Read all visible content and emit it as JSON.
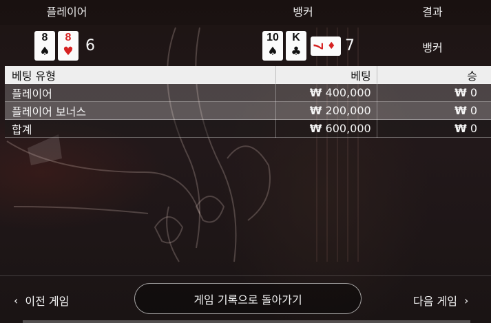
{
  "header": {
    "player": "플레이어",
    "banker": "뱅커",
    "result": "결과"
  },
  "player_hand": {
    "cards": [
      {
        "rank": "8",
        "suit": "♠",
        "color": "black"
      },
      {
        "rank": "8",
        "suit": "♥",
        "color": "red"
      }
    ],
    "score": "6"
  },
  "banker_hand": {
    "cards": [
      {
        "rank": "10",
        "suit": "♠",
        "color": "black"
      },
      {
        "rank": "K",
        "suit": "♣",
        "color": "black"
      }
    ],
    "third_card": {
      "rank": "7",
      "suit": "♦",
      "color": "red"
    },
    "score": "7"
  },
  "result": "뱅커",
  "bets_table": {
    "headers": {
      "type": "베팅 유형",
      "bet": "베팅",
      "win": "승"
    },
    "rows": [
      {
        "type": "플레이어",
        "currency": "₩",
        "bet": "400,000",
        "win": "0"
      },
      {
        "type": "플레이어 보너스",
        "currency": "₩",
        "bet": "200,000",
        "win": "0"
      },
      {
        "type": "합계",
        "currency": "₩",
        "bet": "600,000",
        "win": "0"
      }
    ]
  },
  "footer": {
    "prev_label": "이전 게임",
    "back_label": "게임 기록으로 돌아가기",
    "next_label": "다음 게임"
  },
  "icons": {
    "prev": "chevron-left-icon",
    "next": "chevron-right-icon"
  },
  "colors": {
    "card_red": "#d62222",
    "header_bg": "#eeeeee"
  }
}
